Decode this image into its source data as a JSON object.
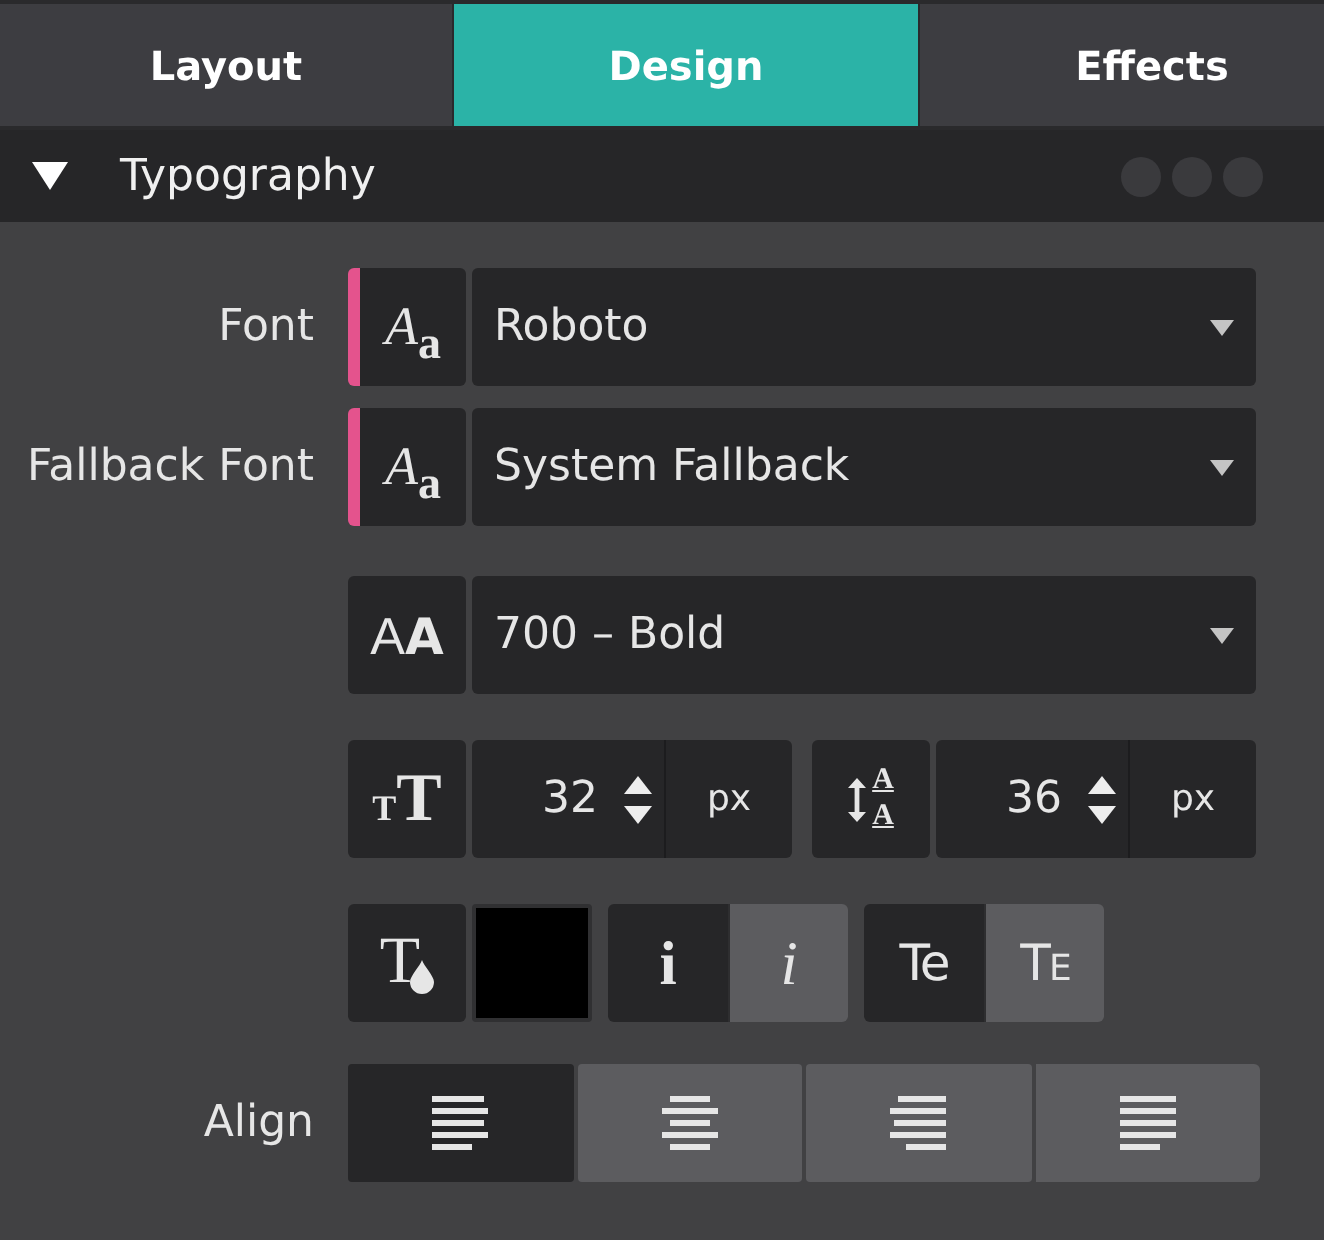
{
  "tabs": [
    {
      "label": "Layout",
      "selected": false
    },
    {
      "label": "Design",
      "selected": true
    },
    {
      "label": "Effects",
      "selected": false
    }
  ],
  "section": {
    "title": "Typography",
    "expanded": true
  },
  "font": {
    "label": "Font",
    "icon_text": "Aa",
    "value": "Roboto",
    "modified": true
  },
  "fallback_font": {
    "label": "Fallback Font",
    "icon_text": "Aa",
    "value": "System Fallback",
    "modified": true
  },
  "font_weight": {
    "icon_text": "AA",
    "value": "700 – Bold",
    "modified": false
  },
  "font_size": {
    "icon_text": "TT",
    "value": "32",
    "unit": "px"
  },
  "line_height": {
    "icon_text": "AA",
    "value": "36",
    "unit": "px"
  },
  "text_color": {
    "icon_text": "T",
    "color": "#000000"
  },
  "font_style": [
    {
      "kind": "normal",
      "label": "i",
      "selected": true
    },
    {
      "kind": "italic",
      "label": "i",
      "selected": false
    }
  ],
  "text_case": [
    {
      "kind": "normal",
      "label": "Te",
      "selected": true
    },
    {
      "kind": "small-caps",
      "label": "TE",
      "selected": false
    }
  ],
  "align": {
    "label": "Align",
    "options": [
      {
        "kind": "left",
        "selected": true
      },
      {
        "kind": "center",
        "selected": false
      },
      {
        "kind": "right",
        "selected": false
      },
      {
        "kind": "justify",
        "selected": false
      }
    ]
  }
}
